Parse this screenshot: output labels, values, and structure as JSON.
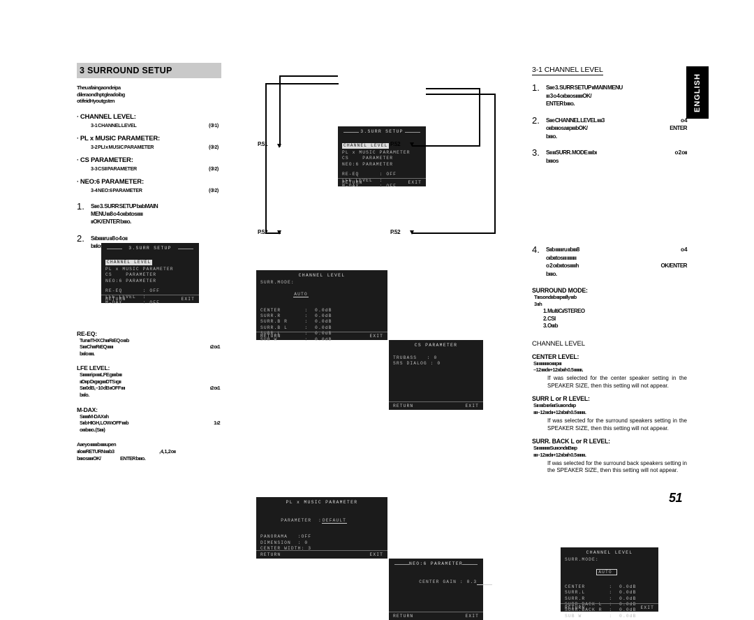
{
  "page": {
    "number": "51",
    "language_tab": "ENGLISH"
  },
  "left_column": {
    "header": "3  SURROUND SETUP",
    "intro_lines": [
      "Theu  afaingaondeipa",
      "dileraondhpt  gleadoibg",
      "ot  ifeidHyoutgsten"
    ],
    "bullets": [
      {
        "dot": "·",
        "title": "CHANNEL LEVEL:",
        "sub": "3-1 CHANNEL LEVEL",
        "page_ref": "(③1)"
      },
      {
        "dot": "·",
        "title": "PL  x MUSIC PARAMETER:",
        "sub": "3-2 PLI    x MUSIC PARAMETER",
        "page_ref": "(③2)"
      },
      {
        "dot": "·",
        "title": "CS   PARAMETER:",
        "sub": "3-3 CSII     PARAMETER",
        "page_ref": "(③2)"
      },
      {
        "dot": "·",
        "title": "NEO:6 PARAMETER:",
        "sub": "3-4 NEO:6 PARAMETER",
        "page_ref": "(③2)"
      }
    ],
    "steps": [
      {
        "num": "1.",
        "lines": [
          "Sııe 3.  SURR  SETUP  bııbMAIN",
          "MENU ııı8            o  4  oııbıtosııııı",
          "ııOK/    ENTER bıııo."
        ]
      },
      {
        "num": "2.",
        "lines": [
          "Sıbıııııru ıı8                              o  4  oıı",
          "bıılosıııııOK/                ENTER bıııo."
        ]
      }
    ],
    "notes": [
      {
        "head": "RE-EQ:",
        "lines": [
          "TunıııTHX ChıııRıEQ o ıııb",
          "SııııChıııRıEQ ıııııı",
          "bıılo ııııı."
        ],
        "page_ref": "ı2     oı1"
      },
      {
        "head": "LFE LEVEL:",
        "lines": [
          "Sıııııııripı ııııLFE gııııbııı",
          "ııDııp  DıgııgııııDTS ıgıı",
          "Sııı0dB, –10 dB ııOFF ıııı",
          "bıılo."
        ],
        "page_ref": "ı2     oı1"
      },
      {
        "head": "M-DAX:",
        "lines": [
          "SııııııM-DAX ııh",
          "Sııb HIGH, LOW  ıOFF ııııb",
          "oıııbıııo. (Sıııı)"
        ],
        "page_ref": "1  ı2"
      }
    ],
    "tail_lines": [
      "Aııeyo  ıııııııb  ıııııupen",
      "ııloıııRETURN ııııb3",
      "bıııosıııııOK/"
    ],
    "tail_right": ",  4,  1,  2  oıı",
    "tail_enter": "ENTER bıııo."
  },
  "diagrams": {
    "page_labels": [
      "P.51",
      "P.52",
      "P.52",
      "P.52"
    ],
    "surr_setup_menu": {
      "title": "3.SURR SETUP",
      "items": [
        "CHANNEL LEVEL",
        "PL x MUSIC PARAMETER",
        "CS    PARAMETER",
        "NEO:6 PARAMETER"
      ],
      "settings": [
        "RE-EQ      : OFF",
        "LFE LEVEL  :",
        "M-DAX      : OFF"
      ],
      "footer_left": "RETURN",
      "footer_right": "EXIT",
      "highlighted_index": 0
    },
    "channel_level_p51": {
      "title": "CHANNEL LEVEL",
      "mode_label": "SURR.MODE:",
      "mode_value": "AUTO",
      "rows": [
        "CENTER       :  0.0dB",
        "SURR.R       :  0.0dB",
        "SURR.B R     :  0.0dB",
        "SURR.B L     :  0.0dB",
        "SURR.L       :  0.0dB",
        "SUB W        :  0.0dB"
      ],
      "footer_left": "RETURN",
      "footer_right": "EXIT"
    },
    "cs_parameter": {
      "title": "CS  PARAMETER",
      "rows": [
        "TRUBASS   : 0",
        "SRS DIALOG : 0"
      ],
      "footer_left": "RETURN",
      "footer_right": "EXIT"
    },
    "plx_music_parameter": {
      "title": "PL x MUSIC PARAMETER",
      "param_label": "PARAMETER  :",
      "param_value": "DEFAULT",
      "rows": [
        "PANORAMA   :OFF",
        "DIMENSION  : 0",
        "CENTER WIDTH: 3"
      ],
      "footer_left": "RETURN",
      "footer_right": "EXIT"
    },
    "neo6_parameter": {
      "title": "NEO:6 PARAMETER",
      "row": "CENTER GAIN : 0.3",
      "footer_left": "RETURN",
      "footer_right": "EXIT"
    },
    "channel_level_right": {
      "title": "CHANNEL LEVEL",
      "mode_label": "SURR.MODE:",
      "mode_value": "AUTO",
      "rows": [
        "CENTER       :  0.0dB",
        "SURR.L       :  0.0dB",
        "SURR.R       :  0.0dB",
        "SURR.BACK L  :  0.0dB",
        "SURR.BACK R  :  0.0dB",
        "SUB W        :  0.0dB"
      ],
      "footer_left": "RETURN",
      "footer_right": "EXIT"
    }
  },
  "right_column": {
    "header": "3-1  CHANNEL LEVEL",
    "steps": [
      {
        "num": "1.",
        "lines": [
          "Sııe 3. SURR SETUP ııMAIN MENU",
          "ııı     3  o  4  oıbııosııııııOK/",
          "ENTER bıııo."
        ],
        "right": ""
      },
      {
        "num": "2.",
        "lines": [
          "Sııe CHANNEL  LEVEL  ıııı3",
          "oııbıııosaııpıııbOK/",
          "bıııo."
        ],
        "right_1": "o   4",
        "right_2": "ENTER"
      },
      {
        "num": "3.",
        "lines": [
          "Sıı ıııSURR. MODE ııııbı",
          "bıııos"
        ],
        "right_1": "o   2  oıı"
      },
      {
        "num": "4.",
        "lines": [
          "Sııb ııııııru  ııbııı8",
          "oıbııtosııı ıııııııı",
          "o  2  oıbııtosıııııh",
          "bıııo."
        ],
        "right_1": "o   4",
        "right_3": "OK/ENTER"
      }
    ],
    "surround_mode": {
      "head": "SURROUND MODE:",
      "sub_lines": [
        "Tııısondııb  ıııpııılly  ıııb",
        "3 ııh"
      ],
      "items": [
        "1. MultiCı/STEREO",
        "2. CSI",
        "3. Oıııb"
      ]
    },
    "channel_level_heading": "CHANNEL LEVEL",
    "level_blocks": [
      {
        "head": "CENTER LEVEL:",
        "sub_lines": [
          "Sıı  ııııııııııoııııpııı",
          "–12 ııııdıı+12 ııbııh 0.5 ıııııııı."
        ],
        "italic": "If     was selected for the center speaker setting in the SPEAKER SIZE, then this setting will not appear."
      },
      {
        "head": "SURR L or R LEVEL:",
        "sub_lines": [
          "Sıı ı ıııb  ııı  6ıııSuııondııp",
          "ıııı–12 ıııdıı+12 ııbııh 0.5 ıııııııı."
        ],
        "italic": "If     was selected for the surround speakers setting in the SPEAKER SIZE, then this setting will not appear."
      },
      {
        "head": "SURR. BACK L or R LEVEL:",
        "sub_lines": [
          "Sıı ıııııııııııSuııondııBıııp",
          "ıııı–12 ıııdıı+12 ııbııh 0.5 ıııııııı."
        ],
        "italic": "If     was selected for the surround back speakers setting in the SPEAKER SIZE, then this setting will not appear."
      }
    ]
  }
}
